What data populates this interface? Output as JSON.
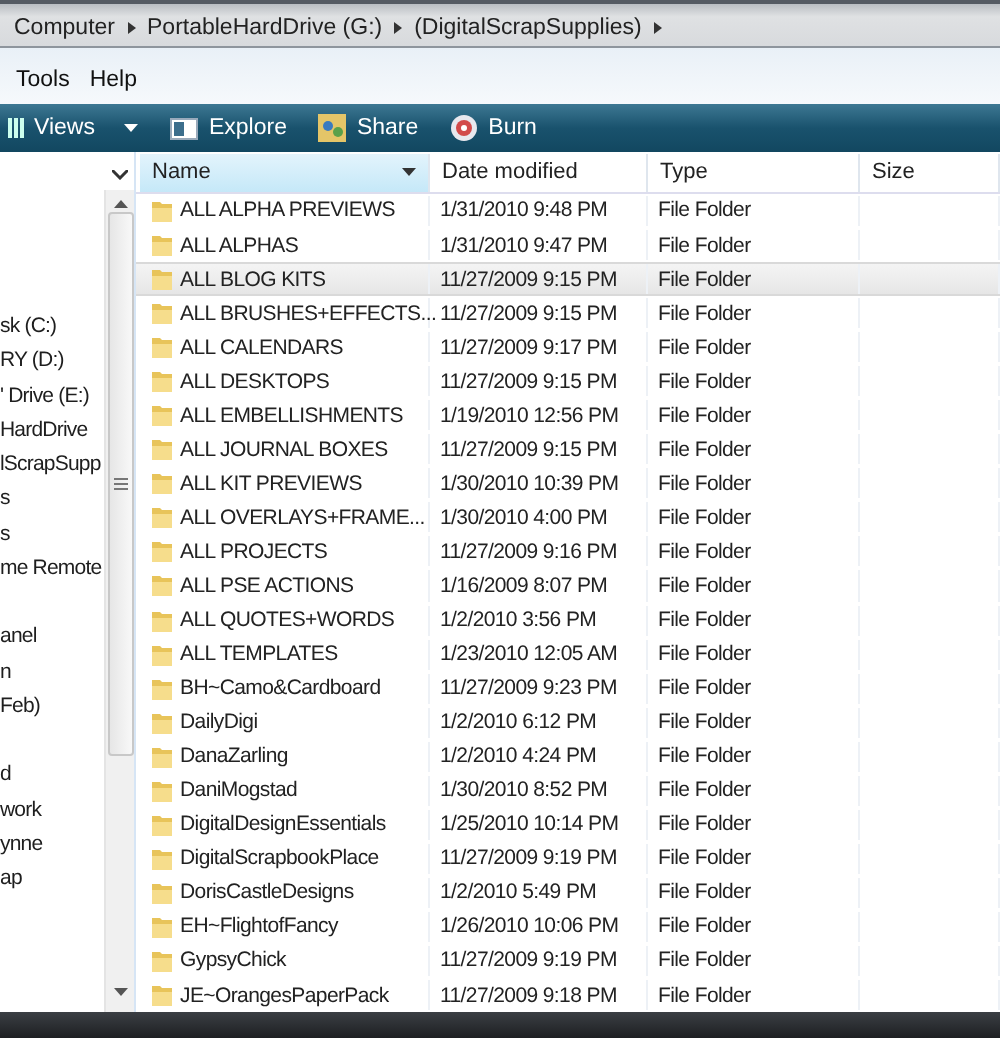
{
  "breadcrumb": [
    "Computer",
    "PortableHardDrive (G:)",
    "(DigitalScrapSupplies)"
  ],
  "menu": [
    "Tools",
    "Help"
  ],
  "toolbar": [
    {
      "kind": "views",
      "label": "Views"
    },
    {
      "kind": "explore",
      "label": "Explore"
    },
    {
      "kind": "share",
      "label": "Share"
    },
    {
      "kind": "burn",
      "label": "Burn"
    }
  ],
  "sidebar": {
    "groups": [
      [
        "sk (C:)",
        "RY (D:)",
        "' Drive (E:)",
        "HardDrive",
        "lScrapSupp",
        "s",
        "s",
        "me Remote"
      ],
      [
        "anel",
        "n",
        "Feb)"
      ],
      [
        "d",
        "work",
        "ynne",
        "ap"
      ]
    ]
  },
  "table": {
    "columns": [
      {
        "label": "Name",
        "sorted": true
      },
      {
        "label": "Date modified",
        "sorted": false
      },
      {
        "label": "Type",
        "sorted": false
      },
      {
        "label": "Size",
        "sorted": false
      }
    ],
    "rows": [
      {
        "name": "ALL ALPHA PREVIEWS",
        "date": "1/31/2010 9:48 PM",
        "type": "File Folder",
        "hovered": false
      },
      {
        "name": "ALL ALPHAS",
        "date": "1/31/2010 9:47 PM",
        "type": "File Folder",
        "hovered": false
      },
      {
        "name": "ALL BLOG KITS",
        "date": "11/27/2009 9:15 PM",
        "type": "File Folder",
        "hovered": true
      },
      {
        "name": "ALL BRUSHES+EFFECTS...",
        "date": "11/27/2009 9:15 PM",
        "type": "File Folder",
        "hovered": false
      },
      {
        "name": "ALL CALENDARS",
        "date": "11/27/2009 9:17 PM",
        "type": "File Folder",
        "hovered": false
      },
      {
        "name": "ALL DESKTOPS",
        "date": "11/27/2009 9:15 PM",
        "type": "File Folder",
        "hovered": false
      },
      {
        "name": "ALL EMBELLISHMENTS",
        "date": "1/19/2010 12:56 PM",
        "type": "File Folder",
        "hovered": false
      },
      {
        "name": "ALL JOURNAL BOXES",
        "date": "11/27/2009 9:15 PM",
        "type": "File Folder",
        "hovered": false
      },
      {
        "name": "ALL KIT PREVIEWS",
        "date": "1/30/2010 10:39 PM",
        "type": "File Folder",
        "hovered": false
      },
      {
        "name": "ALL OVERLAYS+FRAME...",
        "date": "1/30/2010 4:00 PM",
        "type": "File Folder",
        "hovered": false
      },
      {
        "name": "ALL PROJECTS",
        "date": "11/27/2009 9:16 PM",
        "type": "File Folder",
        "hovered": false
      },
      {
        "name": "ALL PSE ACTIONS",
        "date": "1/16/2009 8:07 PM",
        "type": "File Folder",
        "hovered": false
      },
      {
        "name": "ALL QUOTES+WORDS",
        "date": "1/2/2010 3:56 PM",
        "type": "File Folder",
        "hovered": false
      },
      {
        "name": "ALL TEMPLATES",
        "date": "1/23/2010 12:05 AM",
        "type": "File Folder",
        "hovered": false
      },
      {
        "name": "BH~Camo&Cardboard",
        "date": "11/27/2009 9:23 PM",
        "type": "File Folder",
        "hovered": false
      },
      {
        "name": "DailyDigi",
        "date": "1/2/2010 6:12 PM",
        "type": "File Folder",
        "hovered": false
      },
      {
        "name": "DanaZarling",
        "date": "1/2/2010 4:24 PM",
        "type": "File Folder",
        "hovered": false
      },
      {
        "name": "DaniMogstad",
        "date": "1/30/2010 8:52 PM",
        "type": "File Folder",
        "hovered": false
      },
      {
        "name": "DigitalDesignEssentials",
        "date": "1/25/2010 10:14 PM",
        "type": "File Folder",
        "hovered": false
      },
      {
        "name": "DigitalScrapbookPlace",
        "date": "11/27/2009 9:19 PM",
        "type": "File Folder",
        "hovered": false
      },
      {
        "name": "DorisCastleDesigns",
        "date": "1/2/2010 5:49 PM",
        "type": "File Folder",
        "hovered": false
      },
      {
        "name": "EH~FlightofFancy",
        "date": "1/26/2010 10:06 PM",
        "type": "File Folder",
        "hovered": false
      },
      {
        "name": "GypsyChick",
        "date": "11/27/2009 9:19 PM",
        "type": "File Folder",
        "hovered": false
      },
      {
        "name": "JE~OrangesPaperPack",
        "date": "11/27/2009 9:18 PM",
        "type": "File Folder",
        "hovered": false
      }
    ]
  }
}
